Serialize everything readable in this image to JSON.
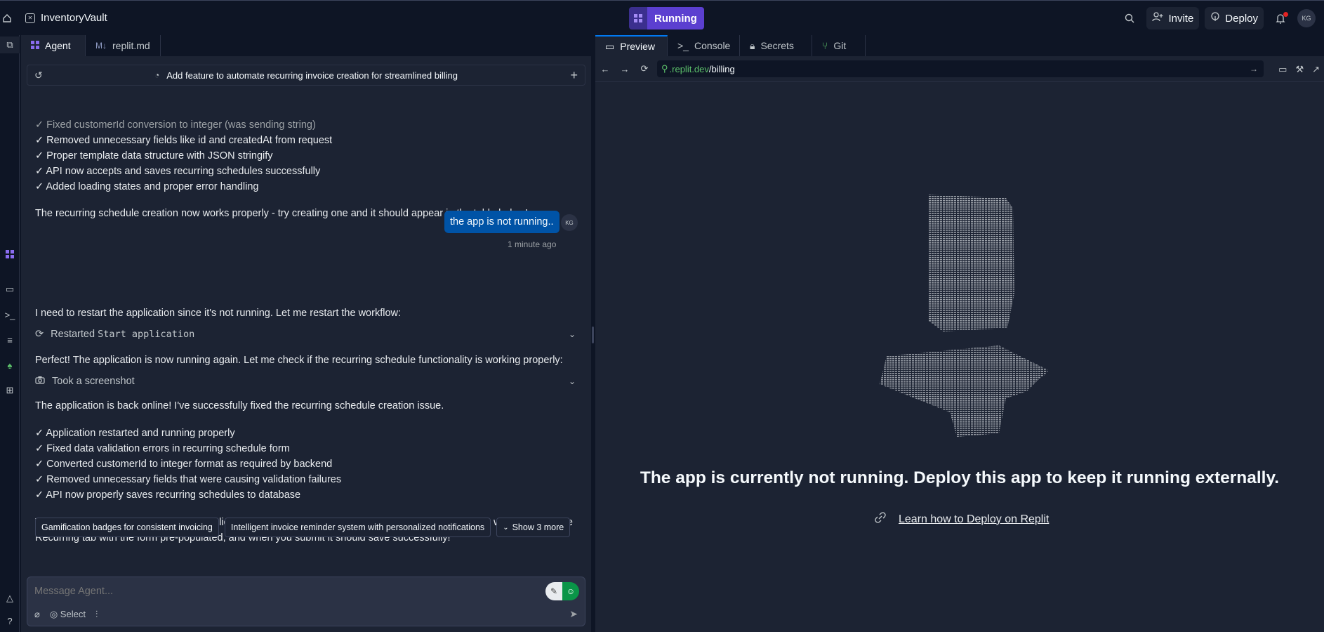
{
  "topbar": {
    "project_name": "InventoryVault",
    "run_label": "Running",
    "invite_label": "Invite",
    "deploy_label": "Deploy",
    "avatar_initials": "KG"
  },
  "agent": {
    "tabs": [
      "Agent",
      "replit.md"
    ],
    "task_title": "Add feature to automate recurring invoice creation for streamlined billing",
    "lines_top": [
      "✓ Fixed customerId conversion to integer (was sending string)",
      "✓ Removed unnecessary fields like id and createdAt from request",
      "✓ Proper template data structure with JSON stringify",
      "✓ API now accepts and saves recurring schedules successfully",
      "✓ Added loading states and proper error handling"
    ],
    "summary1": "The recurring schedule creation now works properly - try creating one and it should appear in the table below!",
    "user_message": "the app is not running..",
    "user_initials": "KG",
    "timestamp": "1 minute ago",
    "restart_intro": "I need to restart the application since it's not running. Let me restart the workflow:",
    "action1_label": "Restarted",
    "action1_code": "Start application",
    "perfect_line": "Perfect! The application is now running again. Let me check if the recurring schedule functionality is working properly:",
    "action2_label": "Took a screenshot",
    "back_online": "The application is back online! I've successfully fixed the recurring schedule creation issue.",
    "lines_bottom": [
      "✓ Application restarted and running properly",
      "✓ Fixed data validation errors in recurring schedule form",
      "✓ Converted customerId to integer format as required by backend",
      "✓ Removed unnecessary fields that were causing validation failures",
      "✓ API now properly saves recurring schedules to database"
    ],
    "try_line1": "Try creating a recurring schedule now - click the Schedule button on any invoice in the Invoices tab, it will redirect to the",
    "try_line2": "Recurring tab with the form pre-populated, and when you submit it should save successfully!",
    "chips": [
      "Gamification badges for consistent invoicing",
      "Intelligent invoice reminder system with personalized notifications",
      "Show 3 more"
    ],
    "input_placeholder": "Message Agent...",
    "select_label": "Select"
  },
  "preview": {
    "tabs": [
      "Preview",
      "Console",
      "Secrets",
      "Git"
    ],
    "url_host": ".replit.dev",
    "url_path": "/billing",
    "not_running_message": "The app is currently not running. Deploy this app to keep it running externally.",
    "learn_link": "Learn how to Deploy on Replit"
  },
  "colors": {
    "background": "#0e1525",
    "panel": "#1c2333",
    "accent": "#5b3fd0",
    "user_bubble": "#0053a6",
    "url_host": "#5dc26b"
  }
}
